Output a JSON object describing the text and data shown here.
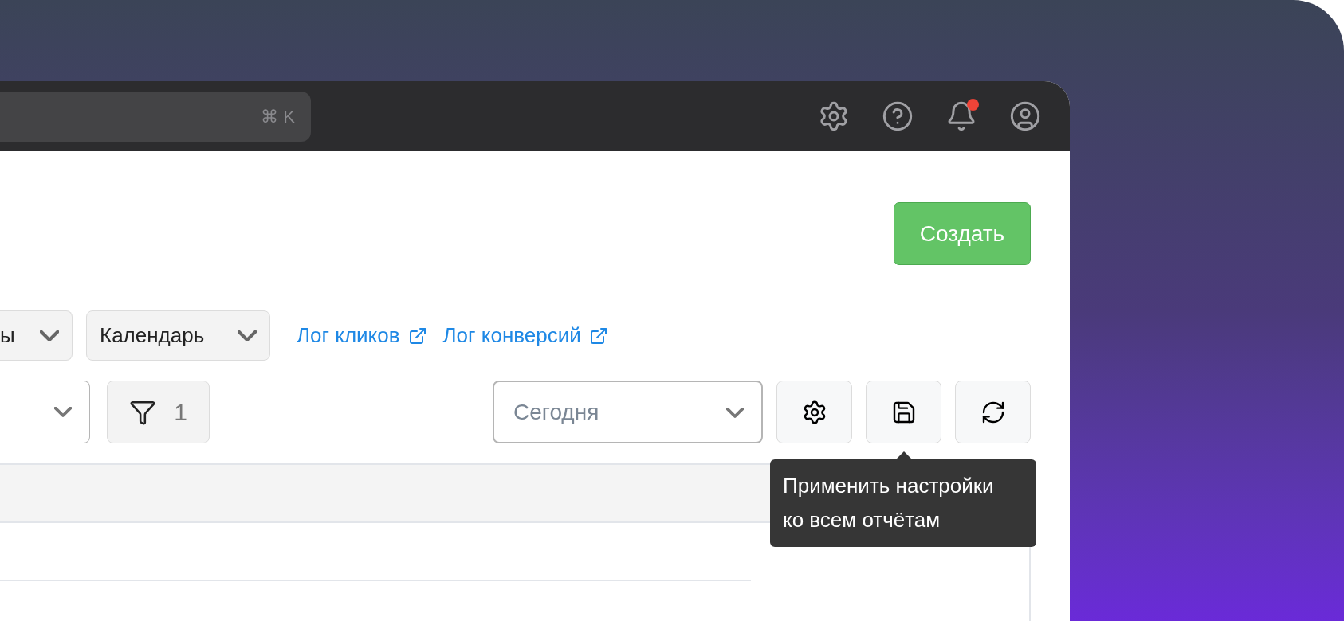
{
  "topbar": {
    "search": {
      "shortcut": "⌘ K"
    },
    "notifications": {
      "unread": true
    }
  },
  "header": {
    "create_button": "Создать"
  },
  "toolbar_1": {
    "dropdowns": [
      {
        "label": "ы"
      },
      {
        "label": "Календарь"
      }
    ],
    "links": [
      "Лог кликов",
      "Лог конверсий"
    ]
  },
  "toolbar_2": {
    "filter_count": "1",
    "period": {
      "placeholder": "Сегодня"
    }
  },
  "tooltip": {
    "text": "Применить настройки ко всем отчётам"
  }
}
